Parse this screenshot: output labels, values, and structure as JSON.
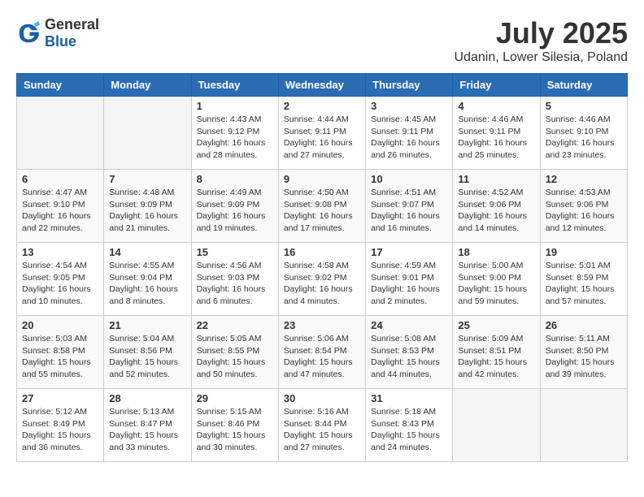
{
  "header": {
    "logo_general": "General",
    "logo_blue": "Blue",
    "title": "July 2025",
    "location": "Udanin, Lower Silesia, Poland"
  },
  "weekdays": [
    "Sunday",
    "Monday",
    "Tuesday",
    "Wednesday",
    "Thursday",
    "Friday",
    "Saturday"
  ],
  "weeks": [
    [
      {
        "day": "",
        "info": ""
      },
      {
        "day": "",
        "info": ""
      },
      {
        "day": "1",
        "info": "Sunrise: 4:43 AM\nSunset: 9:12 PM\nDaylight: 16 hours\nand 28 minutes."
      },
      {
        "day": "2",
        "info": "Sunrise: 4:44 AM\nSunset: 9:11 PM\nDaylight: 16 hours\nand 27 minutes."
      },
      {
        "day": "3",
        "info": "Sunrise: 4:45 AM\nSunset: 9:11 PM\nDaylight: 16 hours\nand 26 minutes."
      },
      {
        "day": "4",
        "info": "Sunrise: 4:46 AM\nSunset: 9:11 PM\nDaylight: 16 hours\nand 25 minutes."
      },
      {
        "day": "5",
        "info": "Sunrise: 4:46 AM\nSunset: 9:10 PM\nDaylight: 16 hours\nand 23 minutes."
      }
    ],
    [
      {
        "day": "6",
        "info": "Sunrise: 4:47 AM\nSunset: 9:10 PM\nDaylight: 16 hours\nand 22 minutes."
      },
      {
        "day": "7",
        "info": "Sunrise: 4:48 AM\nSunset: 9:09 PM\nDaylight: 16 hours\nand 21 minutes."
      },
      {
        "day": "8",
        "info": "Sunrise: 4:49 AM\nSunset: 9:09 PM\nDaylight: 16 hours\nand 19 minutes."
      },
      {
        "day": "9",
        "info": "Sunrise: 4:50 AM\nSunset: 9:08 PM\nDaylight: 16 hours\nand 17 minutes."
      },
      {
        "day": "10",
        "info": "Sunrise: 4:51 AM\nSunset: 9:07 PM\nDaylight: 16 hours\nand 16 minutes."
      },
      {
        "day": "11",
        "info": "Sunrise: 4:52 AM\nSunset: 9:06 PM\nDaylight: 16 hours\nand 14 minutes."
      },
      {
        "day": "12",
        "info": "Sunrise: 4:53 AM\nSunset: 9:06 PM\nDaylight: 16 hours\nand 12 minutes."
      }
    ],
    [
      {
        "day": "13",
        "info": "Sunrise: 4:54 AM\nSunset: 9:05 PM\nDaylight: 16 hours\nand 10 minutes."
      },
      {
        "day": "14",
        "info": "Sunrise: 4:55 AM\nSunset: 9:04 PM\nDaylight: 16 hours\nand 8 minutes."
      },
      {
        "day": "15",
        "info": "Sunrise: 4:56 AM\nSunset: 9:03 PM\nDaylight: 16 hours\nand 6 minutes."
      },
      {
        "day": "16",
        "info": "Sunrise: 4:58 AM\nSunset: 9:02 PM\nDaylight: 16 hours\nand 4 minutes."
      },
      {
        "day": "17",
        "info": "Sunrise: 4:59 AM\nSunset: 9:01 PM\nDaylight: 16 hours\nand 2 minutes."
      },
      {
        "day": "18",
        "info": "Sunrise: 5:00 AM\nSunset: 9:00 PM\nDaylight: 15 hours\nand 59 minutes."
      },
      {
        "day": "19",
        "info": "Sunrise: 5:01 AM\nSunset: 8:59 PM\nDaylight: 15 hours\nand 57 minutes."
      }
    ],
    [
      {
        "day": "20",
        "info": "Sunrise: 5:03 AM\nSunset: 8:58 PM\nDaylight: 15 hours\nand 55 minutes."
      },
      {
        "day": "21",
        "info": "Sunrise: 5:04 AM\nSunset: 8:56 PM\nDaylight: 15 hours\nand 52 minutes."
      },
      {
        "day": "22",
        "info": "Sunrise: 5:05 AM\nSunset: 8:55 PM\nDaylight: 15 hours\nand 50 minutes."
      },
      {
        "day": "23",
        "info": "Sunrise: 5:06 AM\nSunset: 8:54 PM\nDaylight: 15 hours\nand 47 minutes."
      },
      {
        "day": "24",
        "info": "Sunrise: 5:08 AM\nSunset: 8:53 PM\nDaylight: 15 hours\nand 44 minutes."
      },
      {
        "day": "25",
        "info": "Sunrise: 5:09 AM\nSunset: 8:51 PM\nDaylight: 15 hours\nand 42 minutes."
      },
      {
        "day": "26",
        "info": "Sunrise: 5:11 AM\nSunset: 8:50 PM\nDaylight: 15 hours\nand 39 minutes."
      }
    ],
    [
      {
        "day": "27",
        "info": "Sunrise: 5:12 AM\nSunset: 8:49 PM\nDaylight: 15 hours\nand 36 minutes."
      },
      {
        "day": "28",
        "info": "Sunrise: 5:13 AM\nSunset: 8:47 PM\nDaylight: 15 hours\nand 33 minutes."
      },
      {
        "day": "29",
        "info": "Sunrise: 5:15 AM\nSunset: 8:46 PM\nDaylight: 15 hours\nand 30 minutes."
      },
      {
        "day": "30",
        "info": "Sunrise: 5:16 AM\nSunset: 8:44 PM\nDaylight: 15 hours\nand 27 minutes."
      },
      {
        "day": "31",
        "info": "Sunrise: 5:18 AM\nSunset: 8:43 PM\nDaylight: 15 hours\nand 24 minutes."
      },
      {
        "day": "",
        "info": ""
      },
      {
        "day": "",
        "info": ""
      }
    ]
  ]
}
